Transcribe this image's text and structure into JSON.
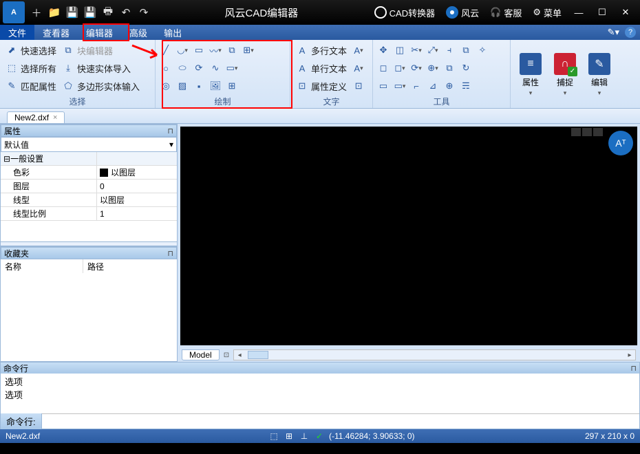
{
  "title_app": "风云CAD编辑器",
  "titlebar_links": {
    "converter": "CAD转换器",
    "brand": "风云",
    "support": "客服",
    "menu": "菜单"
  },
  "menu": {
    "file": "文件",
    "viewer": "查看器",
    "editor": "编辑器",
    "advanced": "高级",
    "output": "输出"
  },
  "ribbon": {
    "select_group": "选择",
    "quick_select": "快速选择",
    "select_all": "选择所有",
    "match_props": "匹配属性",
    "block_editor": "块编辑器",
    "fast_import": "快速实体导入",
    "poly_input": "多边形实体输入",
    "draw_group": "绘制",
    "text_group": "文字",
    "mtext": "多行文本",
    "stext": "单行文本",
    "attdef": "属性定义",
    "tools_group": "工具",
    "props_btn": "属性",
    "snap_btn": "捕捉",
    "edit_btn": "编辑"
  },
  "doc_tab": "New2.dxf",
  "props_panel": {
    "title": "属性",
    "default": "默认值",
    "general": "一般设置",
    "color_k": "色彩",
    "color_v": "以图层",
    "layer_k": "图层",
    "layer_v": "0",
    "ltype_k": "线型",
    "ltype_v": "以图层",
    "lscale_k": "线型比例",
    "lscale_v": "1"
  },
  "fav_panel": {
    "title": "收藏夹",
    "col_name": "名称",
    "col_path": "路径"
  },
  "model_tab": "Model",
  "cmd": {
    "title": "命令行",
    "log1": "选项",
    "log2": "选项",
    "prompt": "命令行:"
  },
  "status": {
    "file": "New2.dxf",
    "coords": "(-11.46284; 3.90633; 0)",
    "dims": "297 x 210 x 0"
  }
}
